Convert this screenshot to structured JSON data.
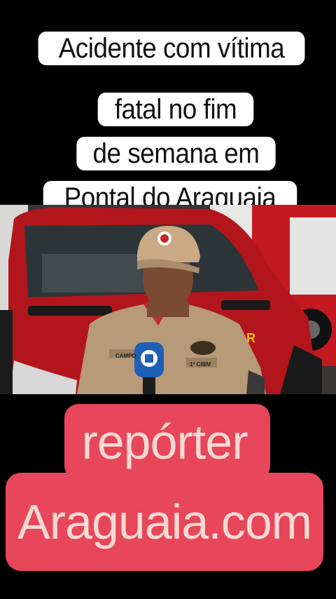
{
  "caption": {
    "lines": [
      "Acidente com vítima",
      "fatal no fim",
      "de semana em",
      "Pontal do Araguaia"
    ]
  },
  "video": {
    "shirt_name": "CAMPO",
    "shirt_unit": "1º CIBM",
    "truck_mark": "R"
  },
  "brand": {
    "line1": "repórter",
    "line2": "Araguaia.com"
  },
  "colors": {
    "caption_bg": "#ffffff",
    "brand_bg": "#e8465a",
    "brand_text": "#f7d9d3",
    "truck_red": "#b2161c",
    "uniform_tan": "#b79a78"
  }
}
